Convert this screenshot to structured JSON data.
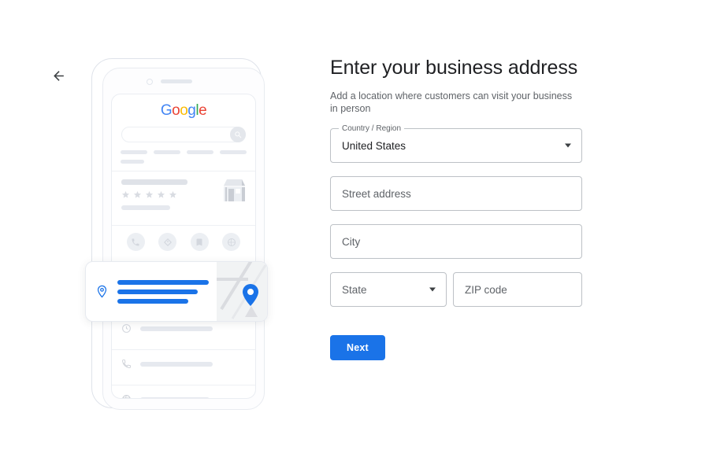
{
  "nav": {
    "back_icon": "arrow-left-icon"
  },
  "illustration": {
    "phone": {
      "logo": {
        "letters": [
          {
            "char": "G",
            "color": "#4285F4"
          },
          {
            "char": "o",
            "color": "#EA4335"
          },
          {
            "char": "o",
            "color": "#FBBC05"
          },
          {
            "char": "g",
            "color": "#4285F4"
          },
          {
            "char": "l",
            "color": "#34A853"
          },
          {
            "char": "e",
            "color": "#EA4335"
          }
        ]
      },
      "search_icon": "magnifier-icon",
      "store_icon": "storefront-icon",
      "rating_stars": 5,
      "actions": [
        {
          "icon": "phone-call-icon"
        },
        {
          "icon": "directions-diamond-icon"
        },
        {
          "icon": "bookmark-save-icon"
        },
        {
          "icon": "share-globe-icon"
        }
      ],
      "chevron_icon": "chevron-right-icon",
      "detail_rows": [
        {
          "icon": "clock-icon"
        },
        {
          "icon": "phone-icon"
        },
        {
          "icon": "globe-icon"
        }
      ]
    },
    "address_card": {
      "pin_icon": "map-pin-outline-icon",
      "map_pin_icon": "map-pin-filled-icon",
      "accent_color": "#1a73e8"
    }
  },
  "form": {
    "title": "Enter your business address",
    "subtitle": "Add a location where customers can visit your business in person",
    "country": {
      "label": "Country / Region",
      "value": "United States",
      "dropdown_icon": "chevron-down-icon"
    },
    "street": {
      "placeholder": "Street address",
      "value": ""
    },
    "city": {
      "placeholder": "City",
      "value": ""
    },
    "state": {
      "placeholder": "State",
      "value": "",
      "dropdown_icon": "chevron-down-icon"
    },
    "zip": {
      "placeholder": "ZIP code",
      "value": ""
    },
    "next_label": "Next",
    "accent_color": "#1a73e8"
  }
}
